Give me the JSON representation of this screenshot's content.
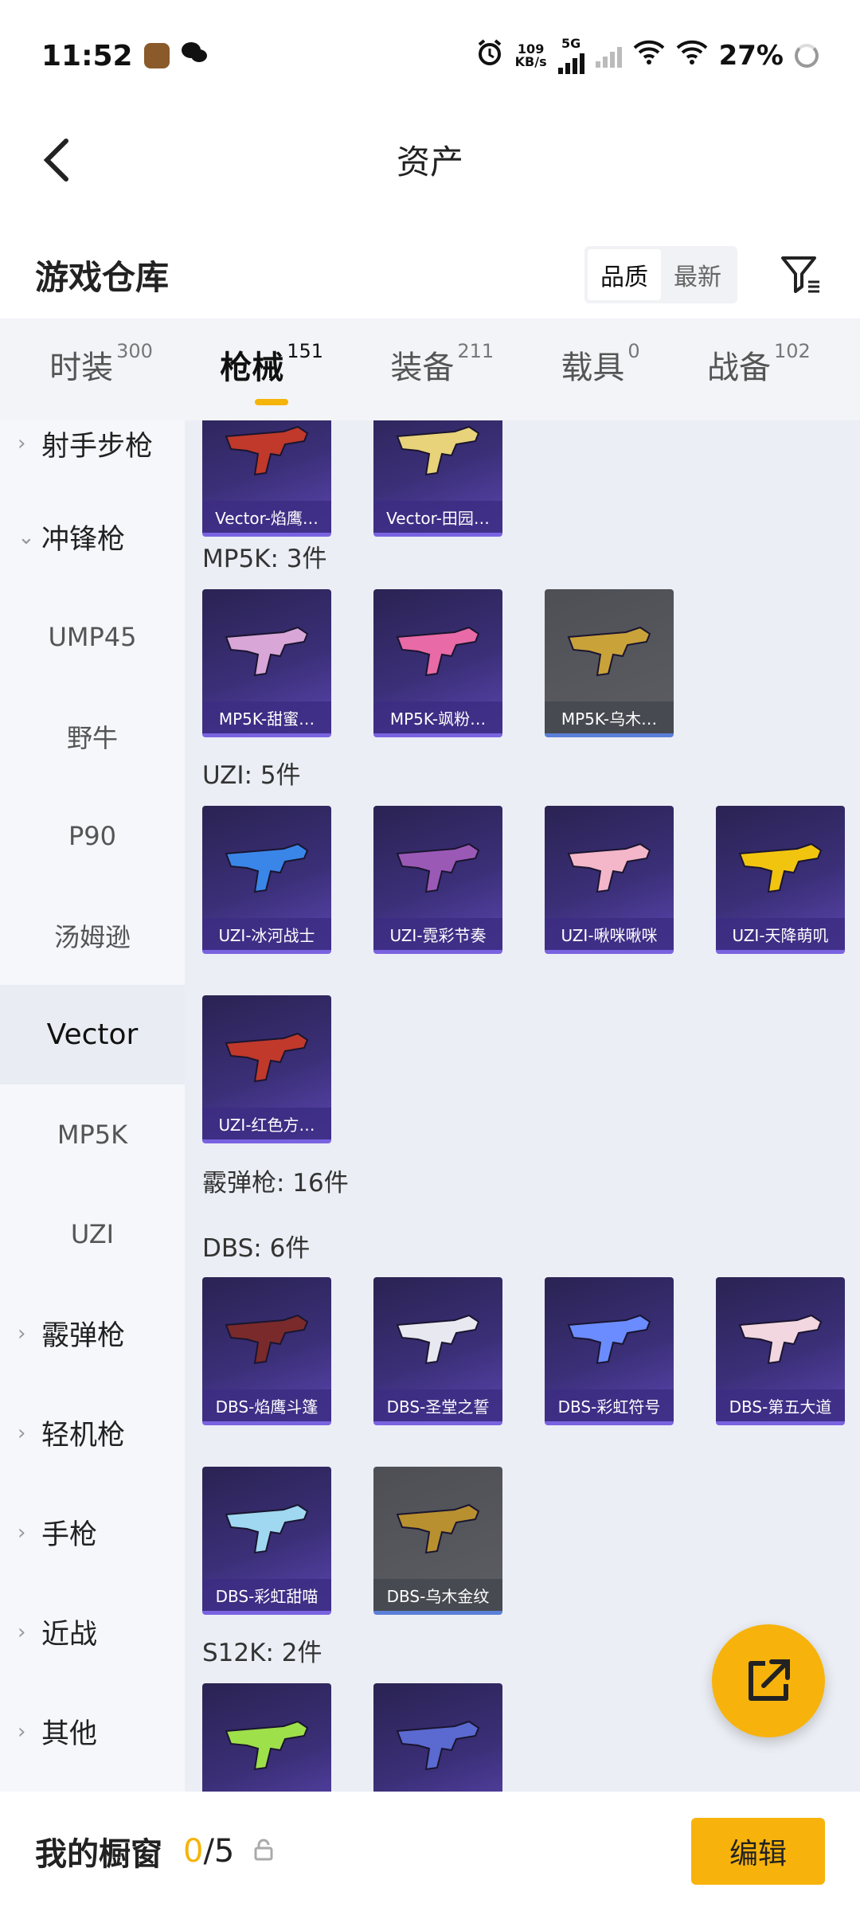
{
  "status_bar": {
    "time": "11:52",
    "net_speed_value": "109",
    "net_speed_unit": "KB/s",
    "network": "5G",
    "battery": "27%"
  },
  "header": {
    "title": "资产"
  },
  "section": {
    "title": "游戏仓库",
    "sort_options": [
      "品质",
      "最新"
    ]
  },
  "tabs": [
    {
      "label": "时装",
      "count": "300"
    },
    {
      "label": "枪械",
      "count": "151"
    },
    {
      "label": "装备",
      "count": "211"
    },
    {
      "label": "载具",
      "count": "0"
    },
    {
      "label": "战备",
      "count": "102"
    }
  ],
  "sidebar": {
    "items": [
      {
        "label": "射手步枪"
      },
      {
        "label": "冲锋枪"
      },
      {
        "label": "UMP45"
      },
      {
        "label": "野牛"
      },
      {
        "label": "P90"
      },
      {
        "label": "汤姆逊"
      },
      {
        "label": "Vector"
      },
      {
        "label": "MP5K"
      },
      {
        "label": "UZI"
      },
      {
        "label": "霰弹枪"
      },
      {
        "label": "轻机枪"
      },
      {
        "label": "手枪"
      },
      {
        "label": "近战"
      },
      {
        "label": "其他"
      }
    ]
  },
  "content": {
    "groups": [
      {
        "title": "MP5K: 3件"
      },
      {
        "title": "UZI: 5件"
      },
      {
        "title": "霰弹枪: 16件"
      },
      {
        "title": "DBS: 6件"
      },
      {
        "title": "S12K: 2件"
      }
    ],
    "cards": [
      {
        "label": "Vector-焰鹰…",
        "color": "#c0392b"
      },
      {
        "label": "Vector-田园…",
        "color": "#e8d27a"
      },
      {
        "label": "MP5K-甜蜜…",
        "color": "#d9a6d8"
      },
      {
        "label": "MP5K-飒粉…",
        "color": "#e86aa6"
      },
      {
        "label": "MP5K-乌木…",
        "color": "#c9a23a"
      },
      {
        "label": "UZI-冰河战士",
        "color": "#3a86e8"
      },
      {
        "label": "UZI-霓彩节奏",
        "color": "#9b59b6"
      },
      {
        "label": "UZI-啾咪啾咪",
        "color": "#f4b6c9"
      },
      {
        "label": "UZI-天降萌叽",
        "color": "#f1c40f"
      },
      {
        "label": "UZI-红色方…",
        "color": "#c0392b"
      },
      {
        "label": "DBS-焰鹰斗篷",
        "color": "#7a2a2a"
      },
      {
        "label": "DBS-圣堂之誓",
        "color": "#e8e8f0"
      },
      {
        "label": "DBS-彩虹符号",
        "color": "#6b8cff"
      },
      {
        "label": "DBS-第五大道",
        "color": "#f2d6e0"
      },
      {
        "label": "DBS-彩虹甜喵",
        "color": "#9fd8f0"
      },
      {
        "label": "DBS-乌木金纹",
        "color": "#b8902f"
      },
      {
        "label": "",
        "color": "#9ee04a"
      },
      {
        "label": "",
        "color": "#5a6ad0"
      }
    ]
  },
  "bottom_bar": {
    "label": "我的橱窗",
    "count_current": "0",
    "count_total": "/5",
    "edit_label": "编辑"
  },
  "colors": {
    "accent": "#f7b30c",
    "card_purple": "#3b2f78"
  }
}
